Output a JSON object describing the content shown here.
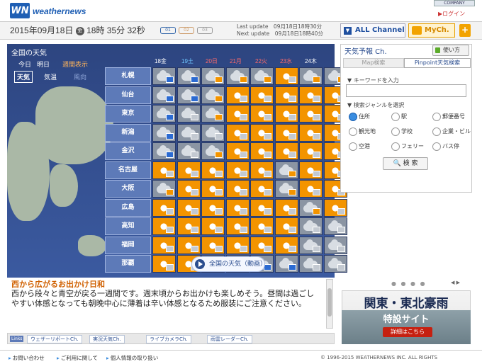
{
  "header": {
    "logo_mark": "WN",
    "logo_text": "weathernews",
    "company_label": "COMPANY",
    "login_label": "ログイン"
  },
  "datebar": {
    "date": "2015年09月18日",
    "weekday": "金",
    "time": "18時 35分 32秒",
    "zone_labels": [
      "01",
      "02",
      "03"
    ],
    "last_update": "Last update　09月18日18時30分",
    "next_update": "Next update　09月18日18時40分",
    "all_channel": "ALL Channel",
    "mych": "MyCh.",
    "plus": "+"
  },
  "panel": {
    "title": "全国の天気",
    "tabs": [
      "今日",
      "明日",
      "週間表示"
    ],
    "subtabs": [
      "天気",
      "気温",
      "風向"
    ],
    "days": [
      {
        "d": "18",
        "w": "金",
        "cls": ""
      },
      {
        "d": "19",
        "w": "土",
        "cls": "sat"
      },
      {
        "d": "20",
        "w": "日",
        "cls": "sun"
      },
      {
        "d": "21",
        "w": "月",
        "cls": "sun"
      },
      {
        "d": "22",
        "w": "火",
        "cls": "sun"
      },
      {
        "d": "23",
        "w": "水",
        "cls": "sun"
      },
      {
        "d": "24",
        "w": "木",
        "cls": ""
      }
    ],
    "cities": [
      "札幌",
      "仙台",
      "東京",
      "新潟",
      "金沢",
      "名古屋",
      "大阪",
      "広島",
      "高知",
      "福岡",
      "那覇"
    ],
    "grid": [
      [
        "c:r",
        "c:r",
        "c:s",
        "c:s",
        "c:s",
        "s:c",
        "c:s",
        "c:s"
      ],
      [
        "c:r",
        "c:r",
        "c:s",
        "s:c",
        "s:c",
        "s:c",
        "s:c",
        "s:c"
      ],
      [
        "c:r",
        "c:c",
        "c:s",
        "s:c",
        "s:c",
        "s:c",
        "s:c",
        "s:c"
      ],
      [
        "c:r",
        "c:c",
        "c:c",
        "s:c",
        "s:c",
        "s:c",
        "s:c",
        "s:c"
      ],
      [
        "c:r",
        "c:c",
        "c:s",
        "s:c",
        "s:c",
        "s:c",
        "s:c",
        "s:c"
      ],
      [
        "s:c",
        "s:c",
        "s:c",
        "s:c",
        "s:c",
        "c:s",
        "s:c",
        "s:c"
      ],
      [
        "c:s",
        "s:c",
        "s:c",
        "s:c",
        "s:c",
        "c:s",
        "s:c",
        "s:c"
      ],
      [
        "s:c",
        "s:c",
        "s:c",
        "s:c",
        "s:c",
        "s:c",
        "c:s",
        "s:c"
      ],
      [
        "s:c",
        "s:c",
        "s:c",
        "s:c",
        "s:c",
        "s:c",
        "c:c",
        "c:c"
      ],
      [
        "s:c",
        "s:c",
        "s:c",
        "s:c",
        "s:c",
        "s:c",
        "c:c",
        "c:c"
      ],
      [
        "s:c",
        "s:c",
        "c:r",
        "c:s",
        "c:r",
        "c:r",
        "c:c",
        "c:c"
      ]
    ],
    "video_label": "全国の天気（動画）"
  },
  "article": {
    "headline": "西から広がるお出かけ日和",
    "body": "西から段々と青空が戻る一週間です。週末頃からお出かけも楽しめそう。昼間は過ごしやすい体感となっても朝晩中心に薄着は辛い体感となるため服装にご注意ください。"
  },
  "linkbar": {
    "label": "Links",
    "items": [
      "ウェザーリポートCh.",
      "実況天気Ch.",
      "ライブカメラCh.",
      "雨雲レーダーCh."
    ]
  },
  "right": {
    "title": "天気予報 Ch.",
    "guide": "使い方",
    "tab_map": "Map検索",
    "tab_pinpoint": "Pinpoint天気検索",
    "keyword_label": "▼ キーワードを入力",
    "genre_label": "▼ 検索ジャンルを選択",
    "options": [
      "住所",
      "駅",
      "郵便番号",
      "観光地",
      "学校",
      "企業・ビル",
      "空港",
      "フェリー",
      "バス停"
    ],
    "search": "🔍 検 索"
  },
  "banner": {
    "title": "関東・東北豪雨",
    "sub": "特設サイト",
    "button": "詳細はこちら",
    "dots": "● ● ● ●",
    "arrows": "◀ ▶"
  },
  "footer": {
    "links": [
      "お問い合わせ",
      "ご利用に関して",
      "個人情報の取り扱い"
    ],
    "copyright": "© 1996-2015 WEATHERNEWS INC. ALL RIGHTS"
  }
}
